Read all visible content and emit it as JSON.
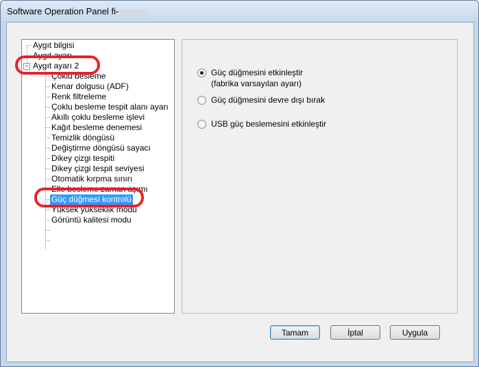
{
  "window": {
    "title": "Software Operation Panel fi-"
  },
  "tree": {
    "items": [
      {
        "label": "Aygıt bilgisi"
      },
      {
        "label": "Aygıt ayarı"
      },
      {
        "label": "Aygıt ayarı 2"
      },
      {
        "label": "Çoklu besleme"
      },
      {
        "label": "Kenar dolgusu (ADF)"
      },
      {
        "label": "Renk filtreleme"
      },
      {
        "label": "Çoklu besleme tespit alanı ayarı"
      },
      {
        "label": "Akıllı çoklu besleme işlevi"
      },
      {
        "label": "Kağıt besleme denemesi"
      },
      {
        "label": "Temizlik döngüsü"
      },
      {
        "label": "Değiştirme döngüsü sayacı"
      },
      {
        "label": "Dikey çizgi tespiti"
      },
      {
        "label": "Dikey çizgi tespit seviyesi"
      },
      {
        "label": "Otomatik kırpma sınırı"
      },
      {
        "label": "Elle besleme zaman aşımı"
      },
      {
        "label": "Güç düğmesi kontrolü",
        "selected": true
      },
      {
        "label": "Yüksek yükseklik modu"
      },
      {
        "label": "Görüntü kalitesi modu"
      }
    ]
  },
  "options": {
    "enable_power_button": {
      "label": "Güç düğmesini etkinleştir",
      "sublabel": "(fabrika varsayılan ayarı)",
      "checked": true
    },
    "disable_power_button": {
      "label": "Güç düğmesini devre dışı bırak",
      "checked": false
    },
    "enable_usb_power": {
      "label": "USB güç beslemesini etkinleştir",
      "checked": false
    }
  },
  "buttons": {
    "ok": "Tamam",
    "cancel": "İptal",
    "apply": "Uygula"
  },
  "colors": {
    "selection": "#3399ff",
    "annotation": "#e8202a"
  }
}
